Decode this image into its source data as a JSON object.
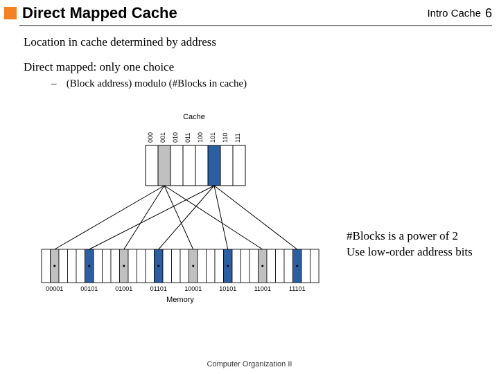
{
  "header": {
    "title": "Direct Mapped Cache",
    "topic": "Intro Cache",
    "page": "6"
  },
  "body": {
    "line1": "Location in cache determined by address",
    "line2": "Direct mapped: only one choice",
    "subdash": "–",
    "subline": "(Block address) modulo (#Blocks in cache)"
  },
  "side": {
    "l1": "#Blocks is a power of 2",
    "l2": "Use low-order address bits"
  },
  "diagram": {
    "cache_title": "Cache",
    "memory_title": "Memory",
    "cache_bins": [
      "000",
      "001",
      "010",
      "011",
      "100",
      "101",
      "110",
      "111"
    ],
    "mem_bins": [
      "00001",
      "00101",
      "01001",
      "01101",
      "10001",
      "10101",
      "11001",
      "11101"
    ]
  },
  "footer": "Computer Organization II"
}
